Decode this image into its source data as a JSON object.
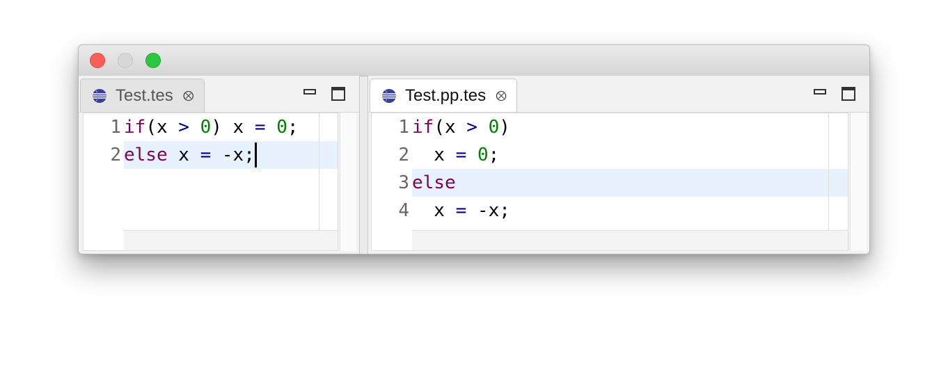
{
  "window": {
    "controls": {
      "close_color": "#fc5f57",
      "minimize_color": "#d7d7d7",
      "zoom_color": "#2ac840"
    }
  },
  "left_pane": {
    "tab": {
      "label": "Test.tes",
      "icon": "eclipse-globe-icon",
      "close_icon": "close-tab-icon",
      "active": false
    },
    "lines": [
      {
        "number": "1",
        "tokens": [
          {
            "t": "if",
            "c": "kw"
          },
          {
            "t": "(x ",
            "c": "plain"
          },
          {
            "t": ">",
            "c": "op"
          },
          {
            "t": " ",
            "c": "plain"
          },
          {
            "t": "0",
            "c": "num"
          },
          {
            "t": ") x ",
            "c": "plain"
          },
          {
            "t": "=",
            "c": "op"
          },
          {
            "t": " ",
            "c": "plain"
          },
          {
            "t": "0",
            "c": "num"
          },
          {
            "t": ";",
            "c": "plain"
          }
        ]
      },
      {
        "number": "2",
        "current": true,
        "caret": true,
        "tokens": [
          {
            "t": "else",
            "c": "kw"
          },
          {
            "t": " x ",
            "c": "plain"
          },
          {
            "t": "=",
            "c": "op"
          },
          {
            "t": " -x;",
            "c": "plain"
          }
        ]
      }
    ]
  },
  "right_pane": {
    "tab": {
      "label": "Test.pp.tes",
      "icon": "eclipse-globe-icon",
      "close_icon": "close-tab-icon",
      "active": true
    },
    "lines": [
      {
        "number": "1",
        "tokens": [
          {
            "t": "if",
            "c": "kw"
          },
          {
            "t": "(x ",
            "c": "plain"
          },
          {
            "t": ">",
            "c": "op"
          },
          {
            "t": " ",
            "c": "plain"
          },
          {
            "t": "0",
            "c": "num"
          },
          {
            "t": ")",
            "c": "plain"
          }
        ]
      },
      {
        "number": "2",
        "tokens": [
          {
            "t": "  x ",
            "c": "plain"
          },
          {
            "t": "=",
            "c": "op"
          },
          {
            "t": " ",
            "c": "plain"
          },
          {
            "t": "0",
            "c": "num"
          },
          {
            "t": ";",
            "c": "plain"
          }
        ]
      },
      {
        "number": "3",
        "current": true,
        "tokens": [
          {
            "t": "else",
            "c": "kw"
          }
        ]
      },
      {
        "number": "4",
        "tokens": [
          {
            "t": "  x ",
            "c": "plain"
          },
          {
            "t": "=",
            "c": "op"
          },
          {
            "t": " -x;",
            "c": "plain"
          }
        ]
      }
    ]
  },
  "colors": {
    "keyword": "#7f0055",
    "operator": "#000080",
    "number": "#008000",
    "current_line": "#e8f2fe"
  }
}
